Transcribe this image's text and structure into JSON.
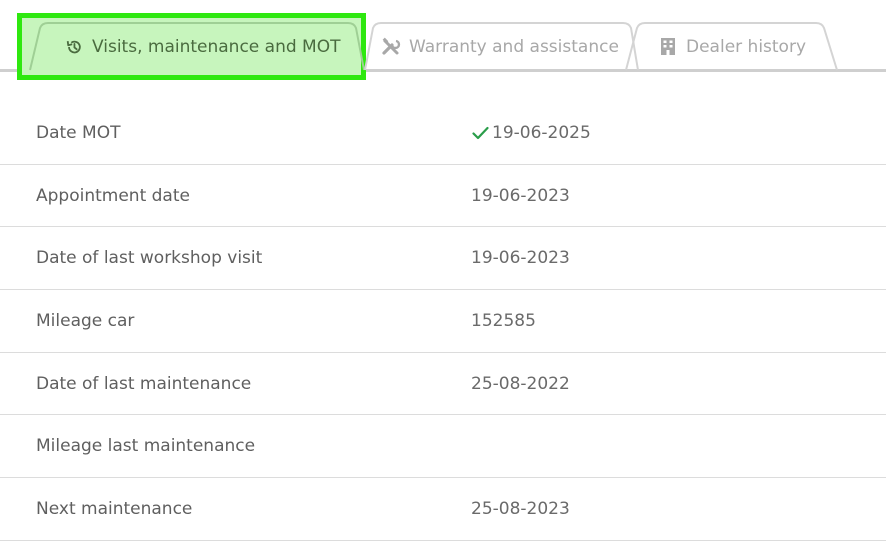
{
  "tabs": [
    {
      "label": "Visits, maintenance and MOT",
      "icon": "history-icon",
      "active": true
    },
    {
      "label": "Warranty and assistance",
      "icon": "tools-icon",
      "active": false
    },
    {
      "label": "Dealer history",
      "icon": "building-icon",
      "active": false
    }
  ],
  "colors": {
    "active_highlight_border": "#2ee80f",
    "active_highlight_fill": "#c7f5bd",
    "check": "#2a9d4a",
    "inactive_tab_text": "#a8a8a8"
  },
  "rows": [
    {
      "label": "Date MOT",
      "value": "19-06-2025",
      "status_icon": "check-icon"
    },
    {
      "label": "Appointment date",
      "value": "19-06-2023"
    },
    {
      "label": "Date of last workshop visit",
      "value": "19-06-2023"
    },
    {
      "label": "Mileage car",
      "value": "152585"
    },
    {
      "label": "Date of last maintenance",
      "value": "25-08-2022"
    },
    {
      "label": "Mileage last maintenance",
      "value": ""
    },
    {
      "label": "Next maintenance",
      "value": "25-08-2023"
    }
  ]
}
